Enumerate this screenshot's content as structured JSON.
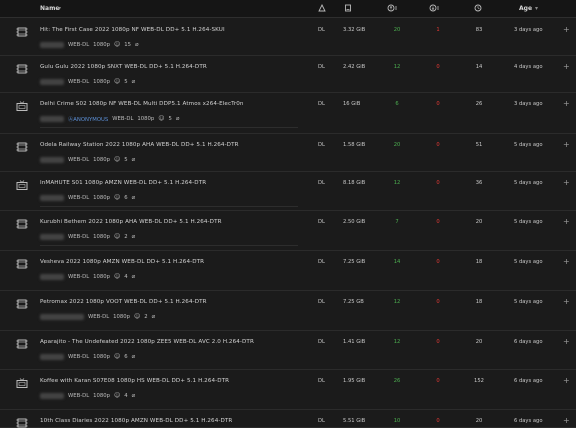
{
  "header": {
    "name": "Name",
    "age": "Age",
    "sort_icon": "sort-caret-icon",
    "icons": [
      "indexer-icon",
      "size-icon",
      "seeders-icon",
      "leechers-icon",
      "grabs-icon"
    ]
  },
  "rows": [
    {
      "type": "film-icon",
      "title": "Hit: The First Case 2022 1080p NF WEB-DL DD+ 5.1 H.264-SKUI",
      "sub": [
        "WEB-DL",
        "1080p",
        "15"
      ],
      "indexer": "DL",
      "size": "3.32 GiB",
      "seeders": "20",
      "leechers": "1",
      "grabs": "83",
      "age": "3 days ago"
    },
    {
      "type": "film-icon",
      "title": "Gulu Gulu 2022 1080p SNXT WEB-DL DD+ 5.1 H.264-DTR",
      "sub": [
        "WEB-DL",
        "1080p",
        "5"
      ],
      "indexer": "DL",
      "size": "2.42 GiB",
      "seeders": "12",
      "leechers": "0",
      "grabs": "14",
      "age": "4 days ago"
    },
    {
      "type": "tv-icon",
      "title": "Delhi Crime S02 1080p NF WEB-DL Multi DDP5.1 Atmos x264-ElecTr0n",
      "sub": [
        "ANONYMOUS",
        "WEB-DL",
        "1080p",
        "5"
      ],
      "indexer": "DL",
      "size": "16 GiB",
      "seeders": "6",
      "leechers": "0",
      "grabs": "26",
      "age": "3 days ago"
    },
    {
      "type": "film-icon",
      "title": "Odela Railway Station 2022 1080p AHA WEB-DL DD+ 5.1 H.264-DTR",
      "sub": [
        "WEB-DL",
        "1080p",
        "5"
      ],
      "indexer": "DL",
      "size": "1.58 GiB",
      "seeders": "20",
      "leechers": "0",
      "grabs": "51",
      "age": "5 days ago"
    },
    {
      "type": "tv-icon",
      "title": "InMAHUTE S01 1080p AMZN WEB-DL DD+ 5.1 H.264-DTR",
      "sub": [
        "WEB-DL",
        "1080p",
        "6"
      ],
      "indexer": "DL",
      "size": "8.18 GiB",
      "seeders": "12",
      "leechers": "0",
      "grabs": "36",
      "age": "5 days ago"
    },
    {
      "type": "film-icon",
      "title": "Kurubhi Bethem 2022 1080p AHA WEB-DL DD+ 5.1 H.264-DTR",
      "sub": [
        "WEB-DL",
        "1080p",
        "2"
      ],
      "indexer": "DL",
      "size": "2.50 GiB",
      "seeders": "7",
      "leechers": "0",
      "grabs": "20",
      "age": "5 days ago"
    },
    {
      "type": "film-icon",
      "title": "Vesheva 2022 1080p AMZN WEB-DL DD+ 5.1 H.264-DTR",
      "sub": [
        "WEB-DL",
        "1080p",
        "4"
      ],
      "indexer": "DL",
      "size": "7.25 GiB",
      "seeders": "14",
      "leechers": "0",
      "grabs": "18",
      "age": "5 days ago"
    },
    {
      "type": "film-icon",
      "title": "Petromax 2022 1080p VOOT WEB-DL DD+ 5.1 H.264-DTR",
      "sub": [
        "WEB-DL",
        "1080p",
        "2"
      ],
      "indexer": "DL",
      "size": "7.25 GB",
      "seeders": "12",
      "leechers": "0",
      "grabs": "18",
      "age": "5 days ago"
    },
    {
      "type": "film-icon",
      "title": "Aparajito - The Undefeated 2022 1080p ZEE5 WEB-DL AVC 2.0 H.264-DTR",
      "sub": [
        "WEB-DL",
        "1080p",
        "6"
      ],
      "indexer": "DL",
      "size": "1.41 GiB",
      "seeders": "12",
      "leechers": "0",
      "grabs": "20",
      "age": "6 days ago"
    },
    {
      "type": "tv-icon",
      "title": "Koffee with Karan S07E08 1080p HS WEB-DL DD+ 5.1 H.264-DTR",
      "sub": [
        "WEB-DL",
        "1080p",
        "4"
      ],
      "indexer": "DL",
      "size": "1.95 GiB",
      "seeders": "26",
      "leechers": "0",
      "grabs": "152",
      "age": "6 days ago"
    },
    {
      "type": "film-icon",
      "title": "10th Class Diaries 2022 1080p AMZN WEB-DL DD+ 5.1 H.264-DTR",
      "sub": [],
      "indexer": "DL",
      "size": "5.51 GiB",
      "seeders": "10",
      "leechers": "0",
      "grabs": "20",
      "age": "6 days ago"
    }
  ]
}
